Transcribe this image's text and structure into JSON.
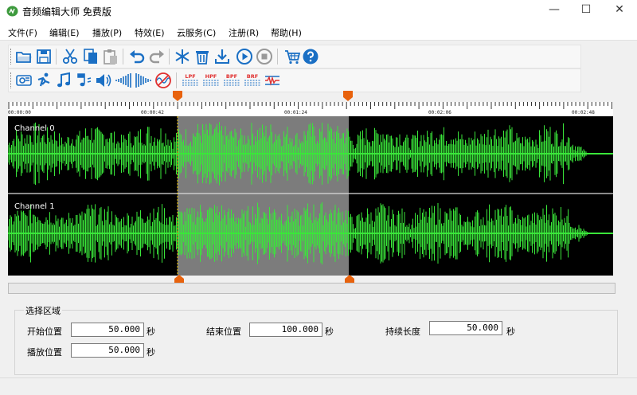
{
  "window": {
    "title": "音频编辑大师 免费版",
    "minimize": "—",
    "maximize": "☐",
    "close": "✕"
  },
  "menu": [
    "文件(F)",
    "编辑(E)",
    "播放(P)",
    "特效(E)",
    "云服务(C)",
    "注册(R)",
    "帮助(H)"
  ],
  "toolbar1": [
    "open-icon",
    "save-icon",
    "cut-icon",
    "copy-icon",
    "paste-icon",
    "undo-icon",
    "redo-icon",
    "snowflake-icon",
    "trash-icon",
    "download-icon",
    "play-icon",
    "stop-icon",
    "cart-icon",
    "help-icon"
  ],
  "toolbar2": [
    "cd-icon",
    "run-icon",
    "music-note-icon",
    "music-notes-icon",
    "volume-icon",
    "fade-in-icon",
    "fade-out-icon",
    "mute-icon",
    "lpf-icon",
    "hpf-icon",
    "bpf-icon",
    "brf-icon",
    "equalizer-icon"
  ],
  "filters": {
    "lpf": "LPF",
    "hpf": "HPF",
    "bpf": "BPF",
    "brf": "BRF"
  },
  "ruler": {
    "labels": [
      "00:00:00",
      "00:00:42",
      "00:01:24",
      "00:02:06",
      "00:02:48"
    ]
  },
  "channels": [
    "Channel 0",
    "Channel 1"
  ],
  "colors": {
    "wave": "#3ae63a",
    "selection": "#7c7c7c",
    "marker": "#e8620c",
    "cursor": "#ffd200"
  },
  "selection": {
    "group_title": "选择区域",
    "start_label": "开始位置",
    "start_value": "50.000",
    "start_unit": "秒",
    "end_label": "结束位置",
    "end_value": "100.000",
    "end_unit": "秒",
    "duration_label": "持续长度",
    "duration_value": "50.000",
    "duration_unit": "秒",
    "play_label": "播放位置",
    "play_value": "50.000",
    "play_unit": "秒"
  }
}
